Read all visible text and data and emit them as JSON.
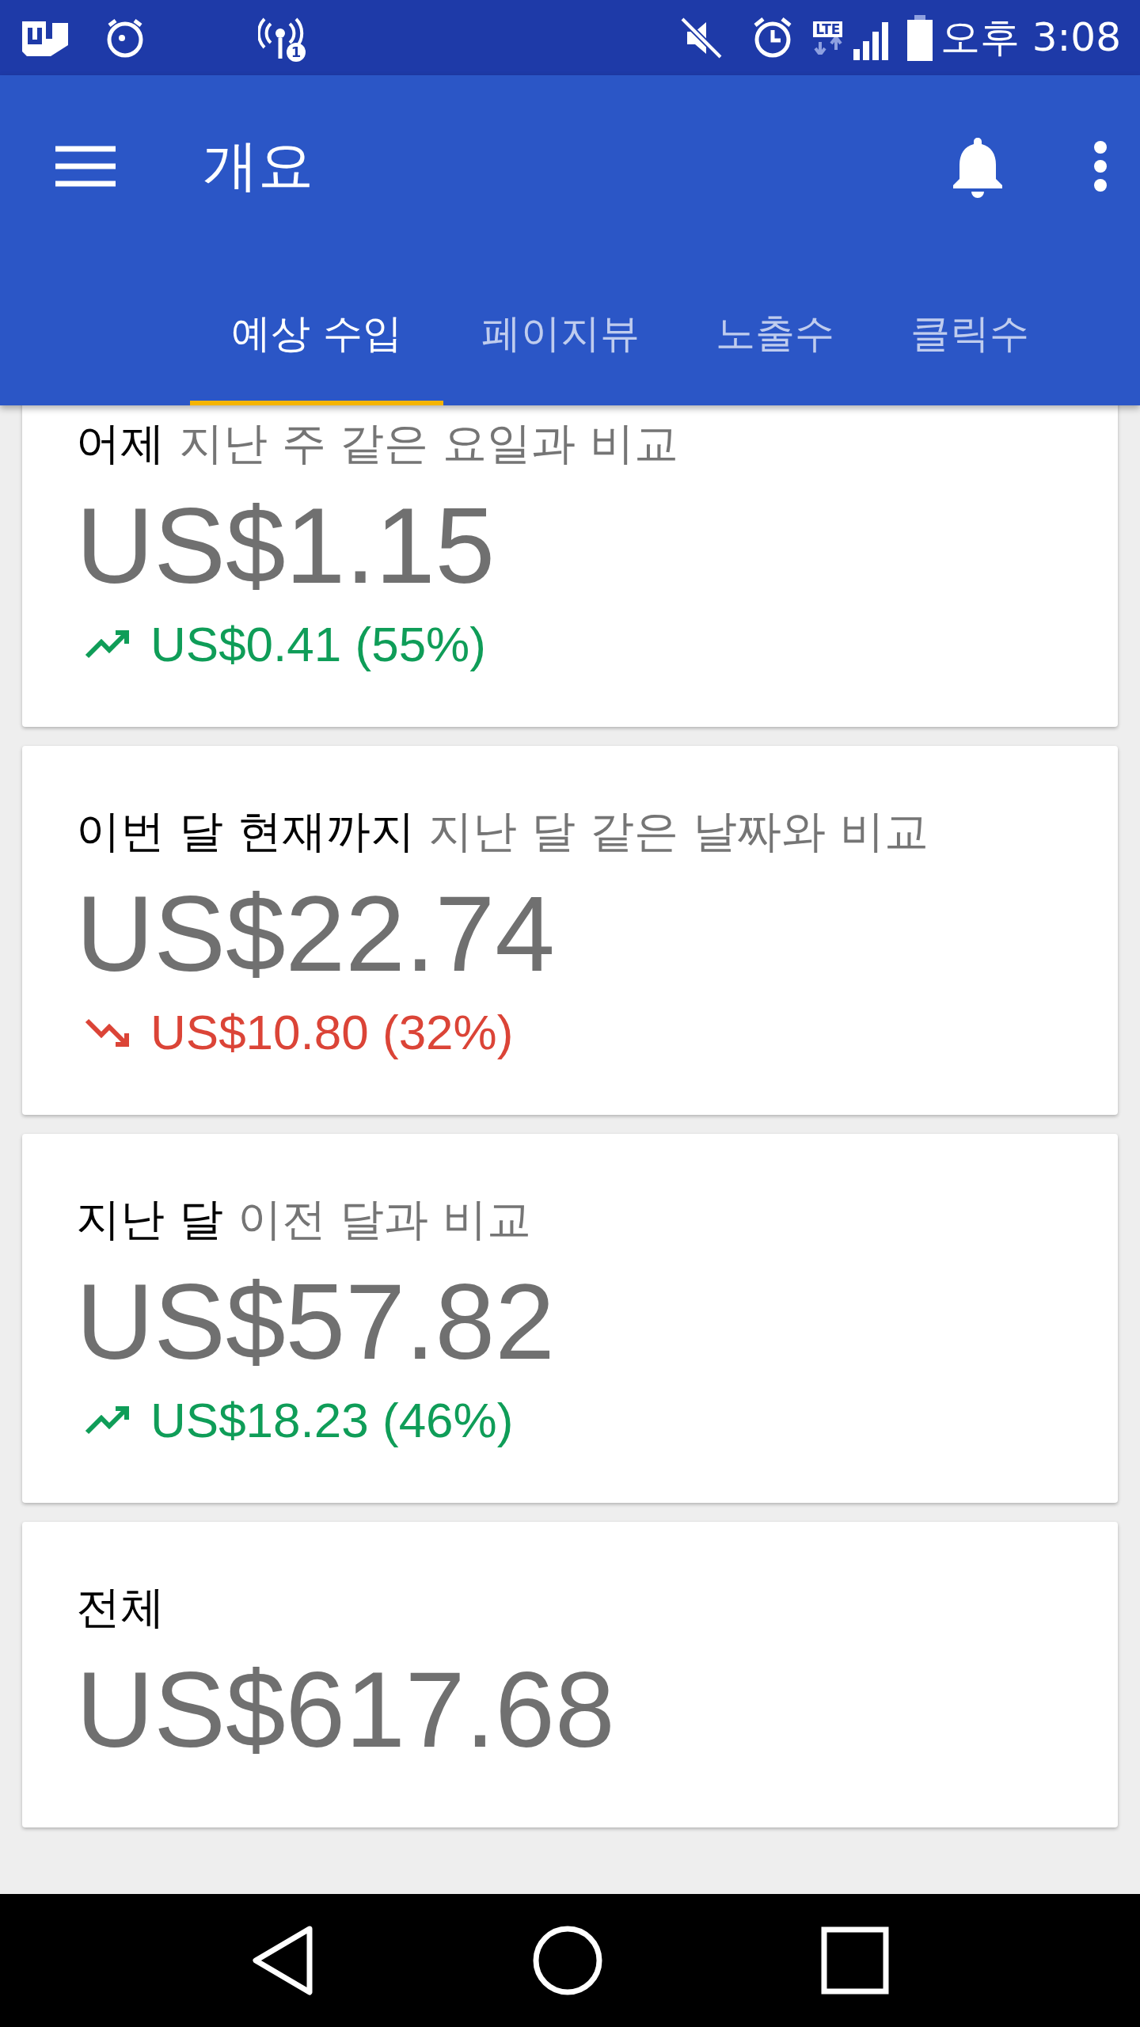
{
  "status_bar": {
    "hotspot_badge": "1",
    "network": "LTE",
    "time": "오후 3:08"
  },
  "app_bar": {
    "title": "개요"
  },
  "tabs": [
    {
      "label": "예상 수입",
      "selected": true
    },
    {
      "label": "페이지뷰",
      "selected": false
    },
    {
      "label": "노출수",
      "selected": false
    },
    {
      "label": "클릭수",
      "selected": false
    }
  ],
  "cards": [
    {
      "period": "어제",
      "comparison": "지난 주 같은 요일과 비교",
      "amount": "US$1.15",
      "change": {
        "kind": "up",
        "text": "US$0.41 (55%)"
      }
    },
    {
      "period": "이번 달 현재까지",
      "comparison": "지난 달 같은 날짜와 비교",
      "amount": "US$22.74",
      "change": {
        "kind": "down",
        "text": "US$10.80 (32%)"
      }
    },
    {
      "period": "지난 달",
      "comparison": "이전 달과 비교",
      "amount": "US$57.82",
      "change": {
        "kind": "up",
        "text": "US$18.23 (46%)"
      }
    },
    {
      "period": "전체",
      "amount": "US$617.68"
    }
  ]
}
